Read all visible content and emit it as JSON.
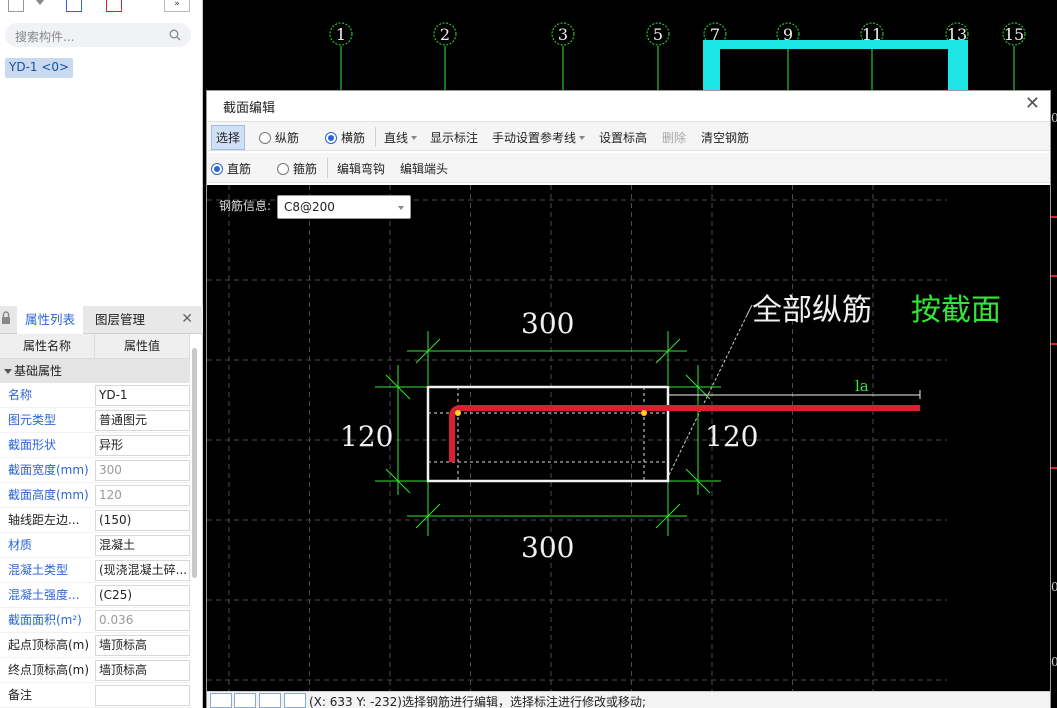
{
  "left_panel": {
    "search_placeholder": "搜索构件...",
    "tree_item": "YD-1 <0>",
    "tabs": [
      "属性列表",
      "图层管理"
    ],
    "table_headers": [
      "属性名称",
      "属性值"
    ],
    "group": "基础属性",
    "rows": [
      {
        "name": "名称",
        "value": "YD-1"
      },
      {
        "name": "图元类型",
        "value": "普通图元"
      },
      {
        "name": "截面形状",
        "value": "异形"
      },
      {
        "name": "截面宽度(mm)",
        "value": "300"
      },
      {
        "name": "截面高度(mm)",
        "value": "120"
      },
      {
        "name": "轴线距左边...",
        "value": "(150)"
      },
      {
        "name": "材质",
        "value": "混凝土"
      },
      {
        "name": "混凝土类型",
        "value": "(现浇混凝土碎..."
      },
      {
        "name": "混凝土强度...",
        "value": "(C25)"
      },
      {
        "name": "截面面积(m²)",
        "value": "0.036"
      },
      {
        "name": "起点顶标高(m)",
        "value": "墙顶标高"
      },
      {
        "name": "终点顶标高(m)",
        "value": "墙顶标高"
      },
      {
        "name": "备注",
        "value": ""
      }
    ]
  },
  "axis_labels": [
    "1",
    "2",
    "3",
    "5",
    "7",
    "9",
    "11",
    "13",
    "15"
  ],
  "dialog": {
    "title": "截面编辑",
    "toolbar1": {
      "select": "选择",
      "longitudinal": "纵筋",
      "transverse": "横筋",
      "line": "直线",
      "show_dim": "显示标注",
      "manual_ref": "手动设置参考线",
      "set_elev": "设置标高",
      "delete": "删除",
      "clear": "清空钢筋"
    },
    "toolbar2": {
      "straight": "直筋",
      "stirrup": "箍筋",
      "edit_hook": "编辑弯钩",
      "edit_end": "编辑端头"
    },
    "rebar_label": "钢筋信息:",
    "rebar_value": "C8@200",
    "drawing": {
      "annotation_white": "全部纵筋",
      "annotation_green": "按截面",
      "dim_top": "300",
      "dim_bottom": "300",
      "dim_left": "120",
      "dim_right": "120",
      "la": "la"
    },
    "status": "(X: 633 Y: -232)选择钢筋进行编辑，选择标注进行修改或移动;"
  },
  "colors": {
    "accent": "#2b64d8",
    "dimension": "#33e633",
    "rebar": "#d92030",
    "cyan": "#1ee6e6"
  }
}
